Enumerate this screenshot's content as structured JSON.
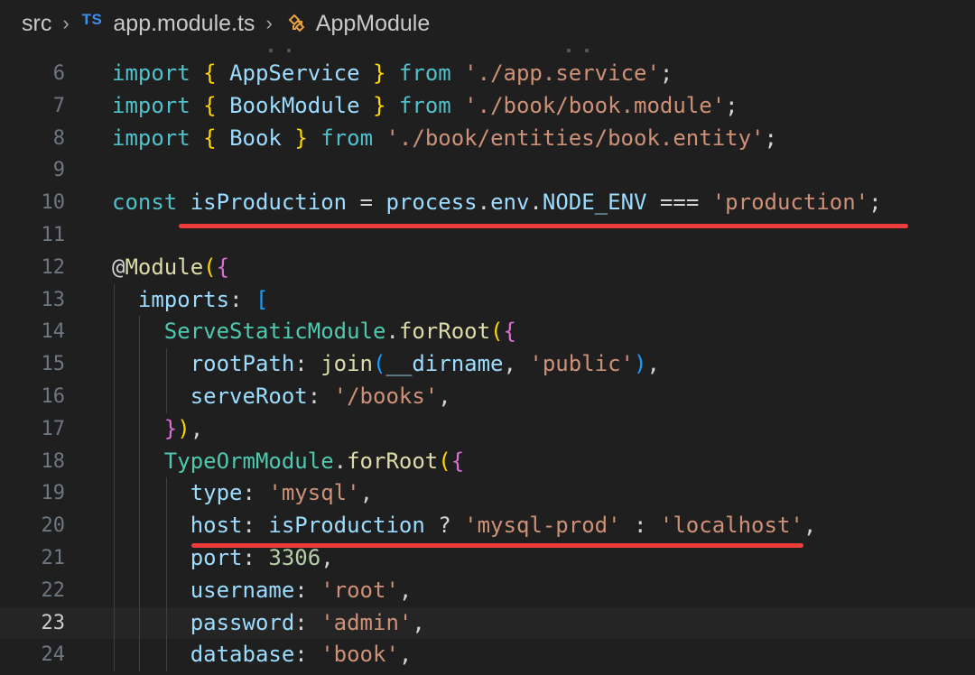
{
  "breadcrumb": {
    "folder": "src",
    "file_badge": "TS",
    "file": "app.module.ts",
    "symbol": "AppModule"
  },
  "colors": {
    "background": "#1f1f1f",
    "highlight_underline": "#ee3b3b"
  },
  "editor": {
    "current_line": 23,
    "lines": [
      {
        "n": "6",
        "tokens": [
          [
            "kw2",
            "import"
          ],
          [
            "punc",
            " "
          ],
          [
            "b1",
            "{"
          ],
          [
            "punc",
            " "
          ],
          [
            "var",
            "AppService"
          ],
          [
            "punc",
            " "
          ],
          [
            "b1",
            "}"
          ],
          [
            "punc",
            " "
          ],
          [
            "kw2",
            "from"
          ],
          [
            "punc",
            " "
          ],
          [
            "str",
            "'./app.service'"
          ],
          [
            "punc",
            ";"
          ]
        ]
      },
      {
        "n": "7",
        "tokens": [
          [
            "kw2",
            "import"
          ],
          [
            "punc",
            " "
          ],
          [
            "b1",
            "{"
          ],
          [
            "punc",
            " "
          ],
          [
            "var",
            "BookModule"
          ],
          [
            "punc",
            " "
          ],
          [
            "b1",
            "}"
          ],
          [
            "punc",
            " "
          ],
          [
            "kw2",
            "from"
          ],
          [
            "punc",
            " "
          ],
          [
            "str",
            "'./book/book.module'"
          ],
          [
            "punc",
            ";"
          ]
        ]
      },
      {
        "n": "8",
        "tokens": [
          [
            "kw2",
            "import"
          ],
          [
            "punc",
            " "
          ],
          [
            "b1",
            "{"
          ],
          [
            "punc",
            " "
          ],
          [
            "var",
            "Book"
          ],
          [
            "punc",
            " "
          ],
          [
            "b1",
            "}"
          ],
          [
            "punc",
            " "
          ],
          [
            "kw2",
            "from"
          ],
          [
            "punc",
            " "
          ],
          [
            "str",
            "'./book/entities/book.entity'"
          ],
          [
            "punc",
            ";"
          ]
        ]
      },
      {
        "n": "9",
        "tokens": []
      },
      {
        "n": "10",
        "tokens": [
          [
            "kw2",
            "const"
          ],
          [
            "punc",
            " "
          ],
          [
            "var",
            "isProduction"
          ],
          [
            "op",
            " = "
          ],
          [
            "var",
            "process"
          ],
          [
            "punc",
            "."
          ],
          [
            "var",
            "env"
          ],
          [
            "punc",
            "."
          ],
          [
            "var",
            "NODE_ENV"
          ],
          [
            "op",
            " === "
          ],
          [
            "str",
            "'production'"
          ],
          [
            "punc",
            ";"
          ]
        ]
      },
      {
        "n": "11",
        "tokens": []
      },
      {
        "n": "12",
        "tokens": [
          [
            "punc",
            "@"
          ],
          [
            "deco",
            "Module"
          ],
          [
            "b1",
            "("
          ],
          [
            "b2",
            "{"
          ]
        ]
      },
      {
        "n": "13",
        "tokens": [
          [
            "punc",
            "  "
          ],
          [
            "prop",
            "imports"
          ],
          [
            "punc",
            ": "
          ],
          [
            "b3",
            "["
          ]
        ]
      },
      {
        "n": "14",
        "tokens": [
          [
            "punc",
            "    "
          ],
          [
            "cls",
            "ServeStaticModule"
          ],
          [
            "punc",
            "."
          ],
          [
            "fn",
            "forRoot"
          ],
          [
            "b1",
            "("
          ],
          [
            "b2",
            "{"
          ]
        ]
      },
      {
        "n": "15",
        "tokens": [
          [
            "punc",
            "      "
          ],
          [
            "prop",
            "rootPath"
          ],
          [
            "punc",
            ": "
          ],
          [
            "fn",
            "join"
          ],
          [
            "b3",
            "("
          ],
          [
            "var",
            "__dirname"
          ],
          [
            "punc",
            ", "
          ],
          [
            "str",
            "'public'"
          ],
          [
            "b3",
            ")"
          ],
          [
            "punc",
            ","
          ]
        ]
      },
      {
        "n": "16",
        "tokens": [
          [
            "punc",
            "      "
          ],
          [
            "prop",
            "serveRoot"
          ],
          [
            "punc",
            ": "
          ],
          [
            "str",
            "'/books'"
          ],
          [
            "punc",
            ","
          ]
        ]
      },
      {
        "n": "17",
        "tokens": [
          [
            "punc",
            "    "
          ],
          [
            "b2",
            "}"
          ],
          [
            "b1",
            ")"
          ],
          [
            "punc",
            ","
          ]
        ]
      },
      {
        "n": "18",
        "tokens": [
          [
            "punc",
            "    "
          ],
          [
            "cls",
            "TypeOrmModule"
          ],
          [
            "punc",
            "."
          ],
          [
            "fn",
            "forRoot"
          ],
          [
            "b1",
            "("
          ],
          [
            "b2",
            "{"
          ]
        ]
      },
      {
        "n": "19",
        "tokens": [
          [
            "punc",
            "      "
          ],
          [
            "prop",
            "type"
          ],
          [
            "punc",
            ": "
          ],
          [
            "str",
            "'mysql'"
          ],
          [
            "punc",
            ","
          ]
        ]
      },
      {
        "n": "20",
        "tokens": [
          [
            "punc",
            "      "
          ],
          [
            "prop",
            "host"
          ],
          [
            "punc",
            ": "
          ],
          [
            "var",
            "isProduction"
          ],
          [
            "op",
            " ? "
          ],
          [
            "str",
            "'mysql-prod'"
          ],
          [
            "op",
            " : "
          ],
          [
            "str",
            "'localhost'"
          ],
          [
            "punc",
            ","
          ]
        ]
      },
      {
        "n": "21",
        "tokens": [
          [
            "punc",
            "      "
          ],
          [
            "prop",
            "port"
          ],
          [
            "punc",
            ": "
          ],
          [
            "num",
            "3306"
          ],
          [
            "punc",
            ","
          ]
        ]
      },
      {
        "n": "22",
        "tokens": [
          [
            "punc",
            "      "
          ],
          [
            "prop",
            "username"
          ],
          [
            "punc",
            ": "
          ],
          [
            "str",
            "'root'"
          ],
          [
            "punc",
            ","
          ]
        ]
      },
      {
        "n": "23",
        "tokens": [
          [
            "punc",
            "      "
          ],
          [
            "prop",
            "password"
          ],
          [
            "punc",
            ": "
          ],
          [
            "str",
            "'admin'"
          ],
          [
            "punc",
            ","
          ]
        ]
      },
      {
        "n": "24",
        "tokens": [
          [
            "punc",
            "      "
          ],
          [
            "prop",
            "database"
          ],
          [
            "punc",
            ": "
          ],
          [
            "str",
            "'book'"
          ],
          [
            "punc",
            ","
          ]
        ]
      }
    ]
  }
}
